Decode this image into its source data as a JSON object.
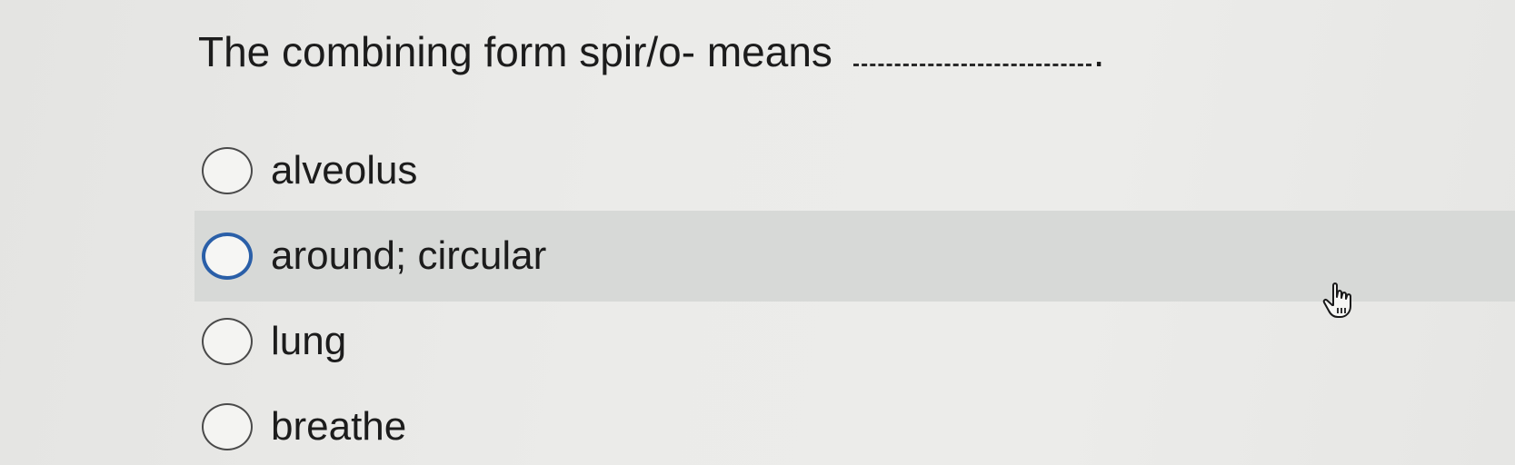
{
  "question": {
    "prompt": "The combining form spir/o- means",
    "period": "."
  },
  "options": [
    {
      "label": "alveolus",
      "state": "unselected"
    },
    {
      "label": "around; circular",
      "state": "hovered"
    },
    {
      "label": "lung",
      "state": "unselected"
    },
    {
      "label": "breathe",
      "state": "unselected"
    }
  ],
  "colors": {
    "hover_background": "#d7d9d7",
    "hover_radio_border": "#2a5fa8",
    "text": "#1c1c1c"
  },
  "cursor": {
    "icon": "hand-pointer-icon"
  }
}
